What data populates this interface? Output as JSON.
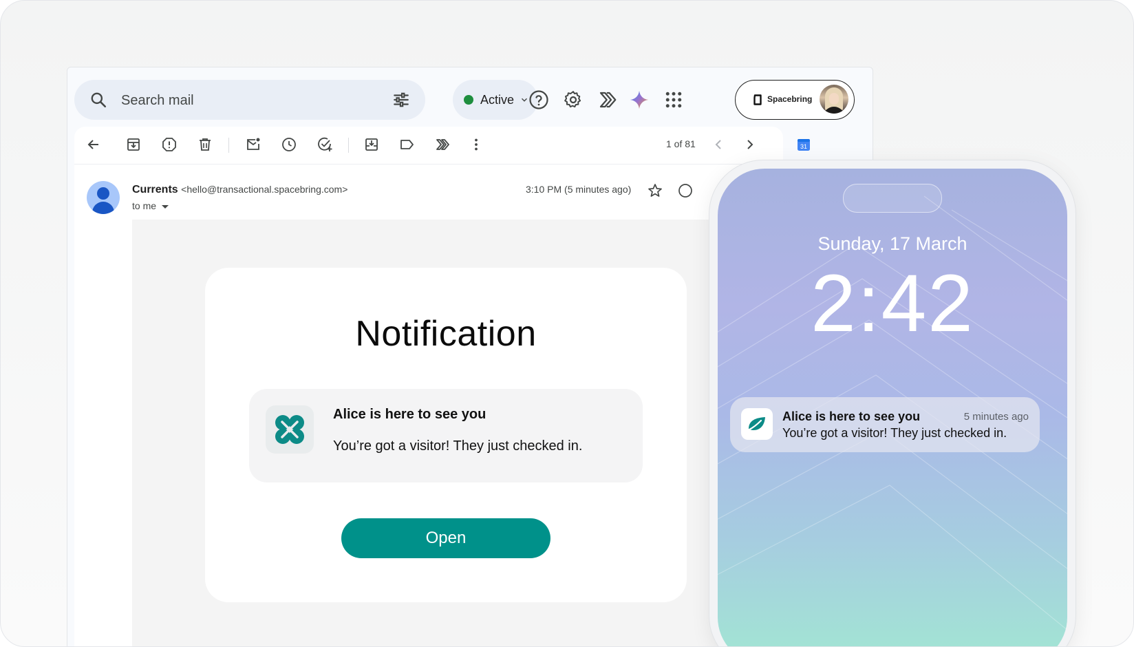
{
  "search": {
    "placeholder": "Search mail"
  },
  "status": {
    "label": "Active"
  },
  "account": {
    "name": "Spacebring"
  },
  "toolbar": {
    "pager": "1 of 81"
  },
  "calendar": {
    "day": "31"
  },
  "message": {
    "sender_name": "Currents",
    "sender_email": "<hello@transactional.spacebring.com>",
    "to": "to me",
    "time": "3:10 PM (5 minutes ago)"
  },
  "email": {
    "title": "Notification",
    "notif_title": "Alice is here to see you",
    "notif_message": "You’re got a visitor! They just checked in.",
    "button": "Open"
  },
  "phone": {
    "date": "Sunday, 17 March",
    "time": "2:42",
    "notif_title": "Alice is here to see you",
    "notif_time": "5 minutes ago",
    "notif_message": "You’re got a visitor! They just checked in."
  },
  "colors": {
    "accent": "#00918a",
    "status_green": "#1e8e3e"
  }
}
